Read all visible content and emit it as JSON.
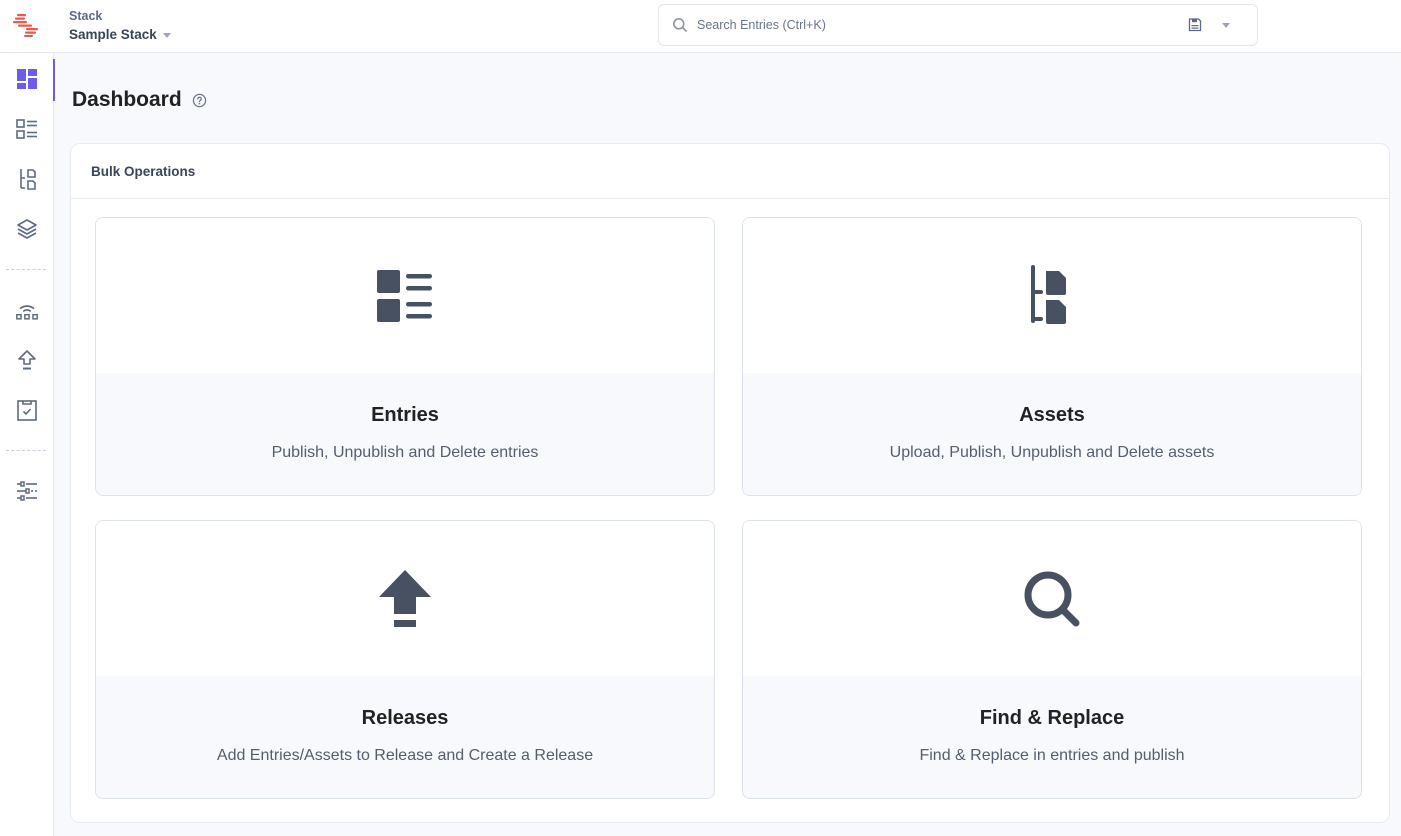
{
  "header": {
    "stack_label": "Stack",
    "stack_name": "Sample Stack",
    "search": {
      "placeholder": "Search Entries (Ctrl+K)",
      "value": ""
    }
  },
  "sidebar": {
    "items": [
      {
        "name": "dashboard",
        "icon": "dashboard-icon",
        "active": true
      },
      {
        "name": "entries",
        "icon": "entries-icon",
        "active": false
      },
      {
        "name": "assets",
        "icon": "assets-icon",
        "active": false
      },
      {
        "name": "content-models",
        "icon": "layers-icon",
        "active": false
      },
      {
        "name": "deployments",
        "icon": "wifi-nodes-icon",
        "active": false
      },
      {
        "name": "releases",
        "icon": "upload-arrow-icon",
        "active": false
      },
      {
        "name": "tasks",
        "icon": "clipboard-check-icon",
        "active": false
      },
      {
        "name": "settings",
        "icon": "sliders-icon",
        "active": false
      }
    ]
  },
  "page": {
    "title": "Dashboard",
    "panel_title": "Bulk Operations",
    "cards": [
      {
        "title": "Entries",
        "description": "Publish, Unpublish and Delete entries",
        "icon": "entries-icon"
      },
      {
        "title": "Assets",
        "description": "Upload, Publish, Unpublish and Delete assets",
        "icon": "assets-icon"
      },
      {
        "title": "Releases",
        "description": "Add Entries/Assets to Release and Create a Release",
        "icon": "upload-arrow-icon"
      },
      {
        "title": "Find & Replace",
        "description": "Find & Replace in entries and publish",
        "icon": "search-icon"
      }
    ]
  },
  "colors": {
    "accent": "#6c5ce7",
    "brand": "#f0574a",
    "icon": "#475161",
    "nav_icon": "#5d6a82"
  }
}
